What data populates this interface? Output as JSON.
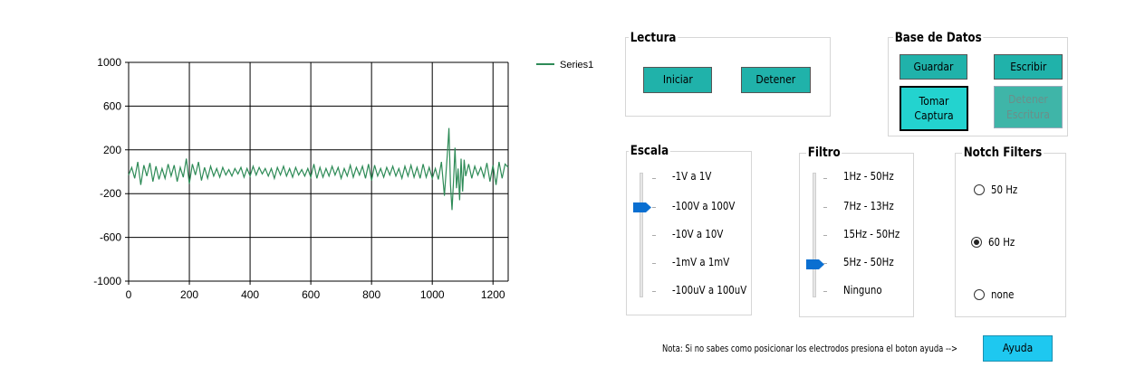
{
  "chart_data": {
    "type": "line",
    "xlim": [
      0,
      1250
    ],
    "ylim": [
      -1000,
      1000
    ],
    "x_ticks": [
      "0",
      "200",
      "400",
      "600",
      "800",
      "1000",
      "1200"
    ],
    "y_ticks": [
      "1000",
      "600",
      "200",
      "-200",
      "-600",
      "-1000"
    ],
    "grid": true,
    "legend_position": "top-right",
    "series": [
      {
        "name": "Series1",
        "color": "#2e8b57",
        "points": [
          [
            0,
            -30
          ],
          [
            10,
            40
          ],
          [
            20,
            -60
          ],
          [
            30,
            90
          ],
          [
            40,
            -120
          ],
          [
            50,
            60
          ],
          [
            60,
            -40
          ],
          [
            70,
            80
          ],
          [
            80,
            -90
          ],
          [
            90,
            50
          ],
          [
            100,
            -70
          ],
          [
            110,
            30
          ],
          [
            120,
            -60
          ],
          [
            130,
            70
          ],
          [
            140,
            -40
          ],
          [
            150,
            60
          ],
          [
            160,
            -90
          ],
          [
            170,
            40
          ],
          [
            180,
            -50
          ],
          [
            190,
            120
          ],
          [
            200,
            -110
          ],
          [
            210,
            70
          ],
          [
            220,
            -30
          ],
          [
            230,
            90
          ],
          [
            240,
            -80
          ],
          [
            250,
            40
          ],
          [
            260,
            -60
          ],
          [
            270,
            50
          ],
          [
            280,
            -40
          ],
          [
            290,
            30
          ],
          [
            300,
            -50
          ],
          [
            310,
            40
          ],
          [
            320,
            -30
          ],
          [
            330,
            20
          ],
          [
            340,
            -40
          ],
          [
            350,
            30
          ],
          [
            360,
            -20
          ],
          [
            370,
            40
          ],
          [
            380,
            -50
          ],
          [
            390,
            30
          ],
          [
            400,
            -40
          ],
          [
            410,
            50
          ],
          [
            420,
            -30
          ],
          [
            430,
            40
          ],
          [
            440,
            -20
          ],
          [
            450,
            30
          ],
          [
            460,
            -40
          ],
          [
            470,
            30
          ],
          [
            480,
            -60
          ],
          [
            490,
            40
          ],
          [
            500,
            -30
          ],
          [
            510,
            50
          ],
          [
            520,
            -40
          ],
          [
            530,
            30
          ],
          [
            540,
            -50
          ],
          [
            550,
            40
          ],
          [
            560,
            -30
          ],
          [
            570,
            20
          ],
          [
            580,
            -40
          ],
          [
            590,
            30
          ],
          [
            600,
            -50
          ],
          [
            610,
            70
          ],
          [
            620,
            -60
          ],
          [
            630,
            40
          ],
          [
            640,
            -50
          ],
          [
            650,
            30
          ],
          [
            660,
            -40
          ],
          [
            670,
            50
          ],
          [
            680,
            -30
          ],
          [
            690,
            40
          ],
          [
            700,
            -60
          ],
          [
            710,
            30
          ],
          [
            720,
            -40
          ],
          [
            730,
            60
          ],
          [
            740,
            -50
          ],
          [
            750,
            40
          ],
          [
            760,
            -30
          ],
          [
            770,
            50
          ],
          [
            780,
            -60
          ],
          [
            790,
            70
          ],
          [
            800,
            -80
          ],
          [
            810,
            60
          ],
          [
            820,
            -40
          ],
          [
            830,
            30
          ],
          [
            840,
            -50
          ],
          [
            850,
            40
          ],
          [
            860,
            -30
          ],
          [
            870,
            50
          ],
          [
            880,
            -40
          ],
          [
            890,
            30
          ],
          [
            900,
            -60
          ],
          [
            910,
            50
          ],
          [
            920,
            -40
          ],
          [
            930,
            60
          ],
          [
            940,
            -50
          ],
          [
            950,
            40
          ],
          [
            960,
            -60
          ],
          [
            970,
            70
          ],
          [
            980,
            -50
          ],
          [
            990,
            40
          ],
          [
            1000,
            -60
          ],
          [
            1010,
            30
          ],
          [
            1020,
            -70
          ],
          [
            1030,
            90
          ],
          [
            1040,
            -220
          ],
          [
            1050,
            180
          ],
          [
            1055,
            400
          ],
          [
            1060,
            -120
          ],
          [
            1065,
            -350
          ],
          [
            1070,
            -80
          ],
          [
            1075,
            220
          ],
          [
            1080,
            -150
          ],
          [
            1085,
            30
          ],
          [
            1090,
            -260
          ],
          [
            1095,
            120
          ],
          [
            1100,
            -180
          ],
          [
            1105,
            110
          ],
          [
            1110,
            -40
          ],
          [
            1120,
            70
          ],
          [
            1130,
            -60
          ],
          [
            1140,
            50
          ],
          [
            1150,
            -30
          ],
          [
            1160,
            40
          ],
          [
            1170,
            -50
          ],
          [
            1180,
            80
          ],
          [
            1190,
            -90
          ],
          [
            1200,
            60
          ],
          [
            1210,
            -120
          ],
          [
            1220,
            90
          ],
          [
            1230,
            -60
          ],
          [
            1240,
            70
          ],
          [
            1250,
            40
          ]
        ]
      }
    ]
  },
  "lectura": {
    "title": "Lectura",
    "iniciar": "Iniciar",
    "detener": "Detener"
  },
  "base_datos": {
    "title": "Base de Datos",
    "guardar": "Guardar",
    "escribir": "Escribir",
    "tomar_captura": "Tomar Captura",
    "detener_escritura": "Detener Escritura"
  },
  "escala": {
    "title": "Escala",
    "options": [
      "-1V a 1V",
      "-100V a 100V",
      "-10V a 10V",
      "-1mV a 1mV",
      "-100uV a 100uV"
    ],
    "selected": "-100V a 100V"
  },
  "filtro": {
    "title": "Filtro",
    "options": [
      "1Hz - 50Hz",
      "7Hz - 13Hz",
      "15Hz - 50Hz",
      "5Hz - 50Hz",
      "Ninguno"
    ],
    "selected": "5Hz - 50Hz"
  },
  "notch": {
    "title": "Notch Filters",
    "options": [
      "50 Hz",
      "60 Hz",
      "none"
    ],
    "selected": "60 Hz"
  },
  "footer": {
    "note": "Nota: Si no sabes como posicionar los electrodos presiona el boton ayuda -->",
    "help_button": "Ayuda"
  },
  "colors": {
    "button": "#20b2aa",
    "button_focused": "#23d3cf",
    "help_button": "#1ec8f0",
    "slider_thumb": "#0a6fd1"
  }
}
